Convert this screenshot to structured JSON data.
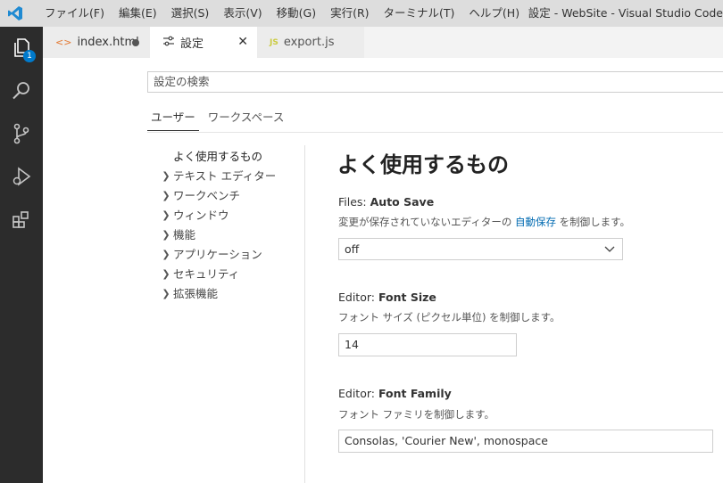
{
  "titlebar": {
    "menus": [
      "ファイル(F)",
      "編集(E)",
      "選択(S)",
      "表示(V)",
      "移動(G)",
      "実行(R)",
      "ターミナル(T)",
      "ヘルプ(H)"
    ],
    "window_title": "設定 - WebSite - Visual Studio Code"
  },
  "activitybar": {
    "explorer_badge": "1",
    "icons": [
      "explorer-icon",
      "search-icon",
      "source-control-icon",
      "run-debug-icon",
      "extensions-icon"
    ]
  },
  "tabs": [
    {
      "label": "index.html",
      "icon": "<>",
      "state": "modified"
    },
    {
      "label": "設定",
      "icon": "settings-icon",
      "state": "active"
    },
    {
      "label": "export.js",
      "icon": "JS",
      "state": "inactive"
    }
  ],
  "settings": {
    "search_placeholder": "設定の検索",
    "scope_tabs": [
      "ユーザー",
      "ワークスペース"
    ],
    "toc": [
      "よく使用するもの",
      "テキスト エディター",
      "ワークベンチ",
      "ウィンドウ",
      "機能",
      "アプリケーション",
      "セキュリティ",
      "拡張機能"
    ],
    "section_title": "よく使用するもの",
    "auto_save": {
      "label_prefix": "Files: ",
      "label_name": "Auto Save",
      "desc_before": "変更が保存されていないエディターの ",
      "desc_link": "自動保存",
      "desc_after": " を制御します。",
      "value": "off"
    },
    "font_size": {
      "label_prefix": "Editor: ",
      "label_name": "Font Size",
      "desc": "フォント サイズ (ピクセル単位) を制御します。",
      "value": "14"
    },
    "font_family": {
      "label_prefix": "Editor: ",
      "label_name": "Font Family",
      "desc": "フォント ファミリを制御します。",
      "value": "Consolas, 'Courier New', monospace"
    }
  },
  "colors": {
    "accent": "#007acc",
    "link": "#006ab1",
    "activitybar": "#2c2c2c"
  }
}
